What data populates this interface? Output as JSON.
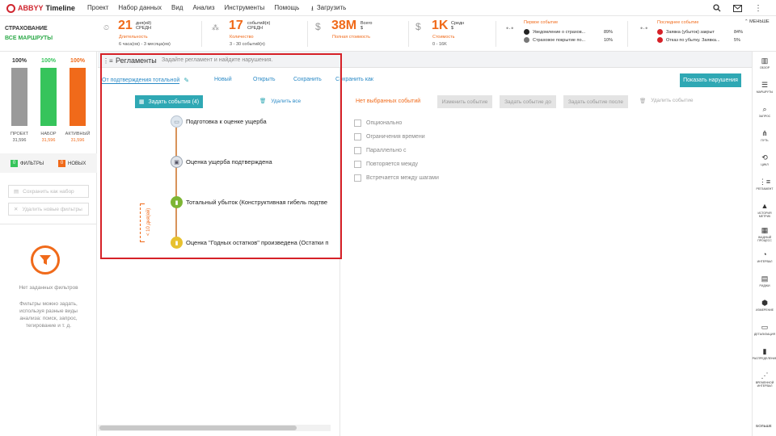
{
  "app": {
    "brand": "ABBYY",
    "product": "Timeline"
  },
  "menu": [
    "Проект",
    "Набор данных",
    "Вид",
    "Анализ",
    "Инструменты",
    "Помощь"
  ],
  "upload_label": "Загрузить",
  "topbar_icons": [
    "search-icon",
    "mail-icon",
    "more-vertical-icon"
  ],
  "kpi": {
    "project_title": "СТРАХОВАНИЕ",
    "project_subtitle": "ВСЕ МАРШРУТЫ",
    "duration": {
      "value": "21",
      "unit1": "дня(ей)",
      "unit2": "СРЕДН",
      "label": "Длительность",
      "range": "6 часа(ов) - 3 месяца(ев)"
    },
    "count": {
      "value": "17",
      "unit1": "событий(я)",
      "unit2": "СРЕДН",
      "label": "Количество",
      "range": "3 - 30 событий(я)"
    },
    "total_cost": {
      "symbol": "$",
      "value": "38M",
      "unit1": "Всего",
      "unit2": "$",
      "label": "Полная стоимость"
    },
    "cost": {
      "symbol": "$",
      "value": "1K",
      "unit1": "Средн",
      "unit2": "$",
      "label": "Стоимость",
      "range": "0 - 16K"
    },
    "first_event": {
      "title": "Первое событие",
      "rows": [
        {
          "label": "Уведомление о страхов...",
          "pct": "89%"
        },
        {
          "label": "Страховое покрытие по...",
          "pct": "10%"
        }
      ]
    },
    "last_event": {
      "title": "Последнее событие",
      "rows": [
        {
          "label": "Заявка (убыток) закрыт",
          "pct": "84%"
        },
        {
          "label": "Отказ по убытку. Заявка...",
          "pct": "5%"
        }
      ]
    },
    "less_label": "МЕНЬШЕ"
  },
  "left": {
    "bars": [
      {
        "pct": "100%",
        "label": "ПРОЕКТ",
        "value": "31,596",
        "color": "#9a9a9a"
      },
      {
        "pct": "100%",
        "label": "НАБОР",
        "value": "31,596",
        "color": "#36c45b"
      },
      {
        "pct": "100%",
        "label": "АКТИВНЫЙ",
        "value": "31,596",
        "color": "#f06a1a"
      }
    ],
    "filters_chip": {
      "count": "0",
      "label": "ФИЛЬТРЫ"
    },
    "new_chip": {
      "count": "0",
      "label": "НОВЫХ"
    },
    "save_set": "Сохранить как набор",
    "delete_new_filters": "Удалить новые фильтры",
    "no_filters": "Нет заданных фильтров",
    "hint": "Фильтры можно задать, используя разные виды анализа: поиск, запрос, тегирование и т. д."
  },
  "regs": {
    "title": "Регламенты",
    "hint": "Задайте регламент и найдите нарушения.",
    "current_name": "От подтверждения тотальной",
    "actions": [
      "Новый",
      "Открыть",
      "Сохранить",
      "Сохранить как"
    ],
    "show_violations": "Показать нарушения",
    "set_events": "Задать события (4)",
    "delete_all": "Удалить все",
    "no_selected": "Нет выбранных событий",
    "event_buttons": [
      "Изменить событие",
      "Задать событие до",
      "Задать событие после",
      "Удалить событие"
    ],
    "options": [
      "Опционально",
      "Ограничения времени",
      "Параллельно с",
      "Повторяется между",
      "Встречается между шагами"
    ],
    "steps": [
      {
        "label": "Подготовка к оценке ущерба",
        "color": "#dfe7ef"
      },
      {
        "label": "Оценка ущерба подтверждена",
        "color": "#e0e4ea"
      },
      {
        "label": "Тотальный убыток (Конструктивная гибель подтве",
        "color": "#7db534"
      },
      {
        "label": "Оценка \"Годных остатков\" произведена (Остатки п",
        "color": "#e7c12f"
      }
    ],
    "duration_constraint": "< 10 дня(ей)"
  },
  "rightbar": [
    {
      "icon": "overview-icon",
      "label": "ОБЗОР"
    },
    {
      "icon": "routes-icon",
      "label": "МАРШРУТЫ"
    },
    {
      "icon": "query-icon",
      "label": "ЗАПРОС"
    },
    {
      "icon": "path-icon",
      "label": "ПУТЬ"
    },
    {
      "icon": "loops-icon",
      "label": "ЦИКЛ"
    },
    {
      "icon": "regulation-icon",
      "label": "РЕГЛАМЕНТ"
    },
    {
      "icon": "history-metric-icon",
      "label": "ИСТОРИЯ МЕТРИК"
    },
    {
      "icon": "task-miner-icon",
      "label": "ЖАДНЫЙ ПРОЦЕСС"
    },
    {
      "icon": "interval-icon",
      "label": "ИНТЕРВАЛ"
    },
    {
      "icon": "rhythm-icon",
      "label": "РИДЖИ"
    },
    {
      "icon": "measure-icon",
      "label": "ИЗМЕРЕНИЕ"
    },
    {
      "icon": "detail-icon",
      "label": "ДЕТАЛИЗАЦИЯ"
    },
    {
      "icon": "distribution-icon",
      "label": "РАСПРЕДЕЛЕНИЕ"
    },
    {
      "icon": "time-interval-icon",
      "label": "ВРЕМЕННОЙ ИНТЕРВАЛ"
    }
  ],
  "rightbar_more": "БОЛЬШЕ"
}
